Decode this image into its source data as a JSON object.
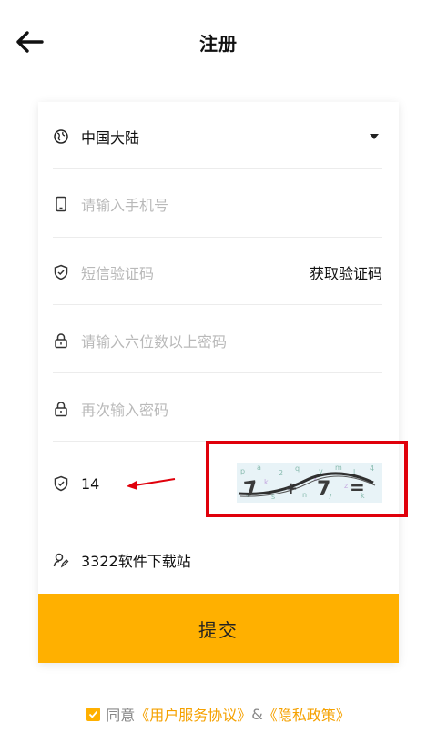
{
  "header": {
    "title": "注册"
  },
  "form": {
    "region": "中国大陆",
    "phone_placeholder": "请输入手机号",
    "sms_placeholder": "短信验证码",
    "get_code_label": "获取验证码",
    "password_placeholder": "请输入六位数以上密码",
    "confirm_placeholder": "再次输入密码",
    "captcha_value": "14",
    "invite_value": "3322软件下载站"
  },
  "submit_label": "提交",
  "agreement": {
    "prefix": "同意",
    "terms_link": "《用户服务协议》",
    "and": "&",
    "privacy_link": "《隐私政策》",
    "checked": true
  },
  "colors": {
    "accent": "#ffb000",
    "highlight": "#e0000b",
    "link": "#f5a100"
  },
  "icons": [
    "back-arrow-icon",
    "globe-icon",
    "phone-icon",
    "shield-icon",
    "lock-icon",
    "user-edit-icon",
    "dropdown-caret-icon",
    "checkbox-checked-icon"
  ]
}
